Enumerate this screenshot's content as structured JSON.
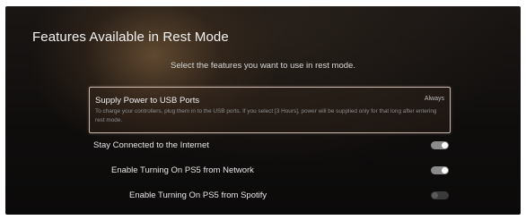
{
  "page": {
    "title": "Features Available in Rest Mode",
    "subtitle": "Select the features you want to use in rest mode."
  },
  "settings": [
    {
      "label": "Supply Power to USB Ports",
      "value": "Always",
      "description": "To charge your controllers, plug them in to the USB ports. If you select [3 Hours], power will be supplied only for that long after entering rest mode.",
      "selected": true
    },
    {
      "label": "Stay Connected to the Internet",
      "enabled": true
    },
    {
      "label": "Enable Turning On PS5 from Network",
      "enabled": true
    },
    {
      "label": "Enable Turning On PS5 from Spotify",
      "enabled": false
    }
  ],
  "colors": {
    "background": "#110f0e",
    "focus_border": "#e6d2c8",
    "toggle_on": "#8a8a8a",
    "toggle_off": "#3a3a3a"
  }
}
